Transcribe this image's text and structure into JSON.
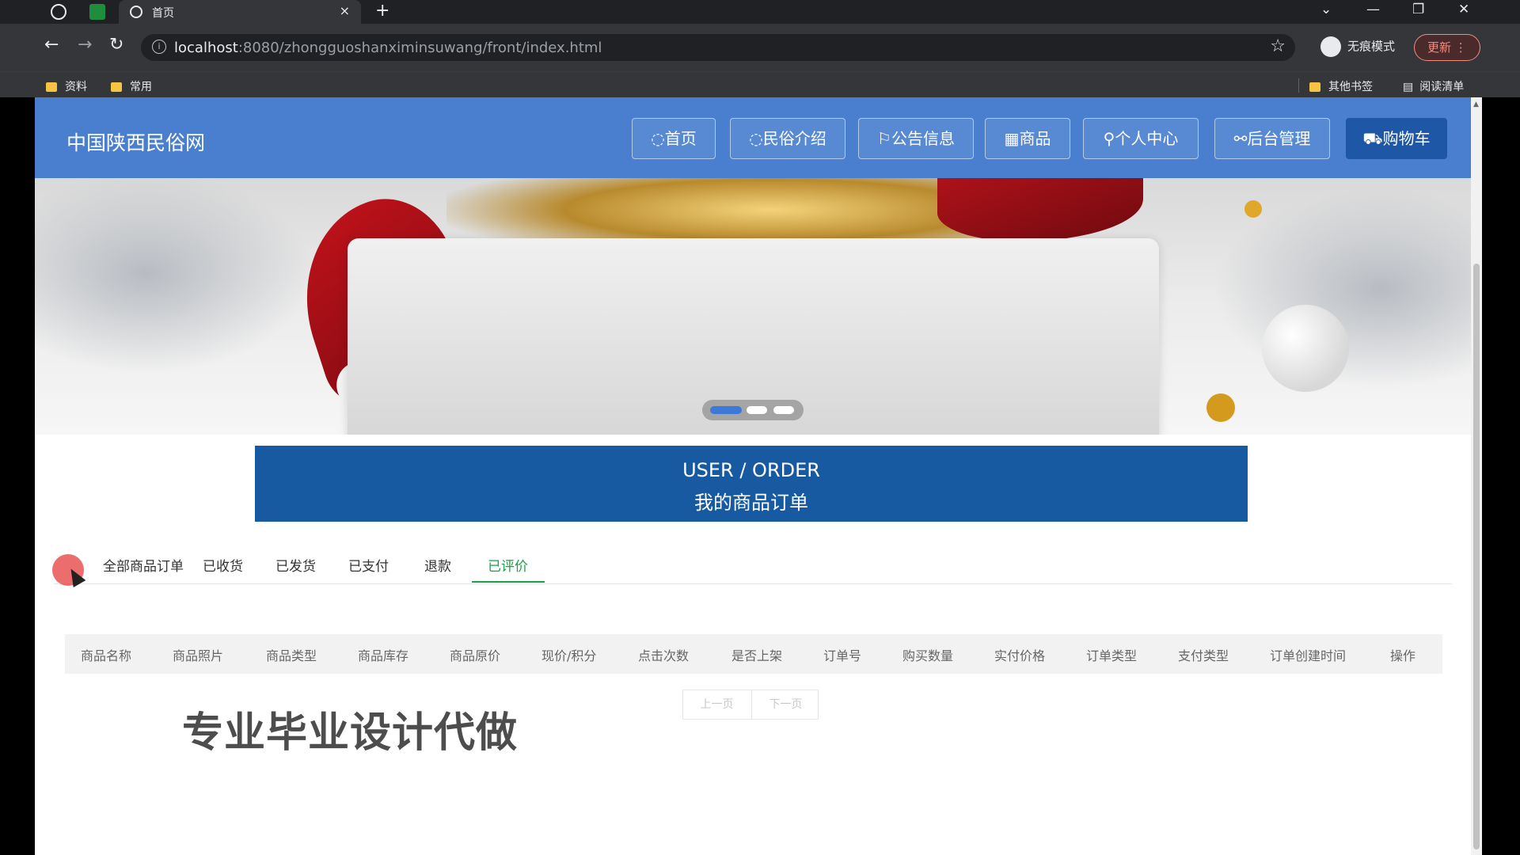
{
  "browser": {
    "tab_title": "首页",
    "tab_close": "×",
    "new_tab": "+",
    "url_host": "localhost",
    "url_rest": ":8080/zhongguoshanximinsuwang/front/index.html",
    "incognito_label": "无痕模式",
    "update_label": "更新",
    "bookmarks": [
      "资料",
      "常用"
    ],
    "other_bookmarks": "其他书签",
    "reading_list": "阅读清单"
  },
  "site": {
    "brand": "中国陕西民俗网",
    "nav": [
      "◌首页",
      "◌民俗介绍",
      "⚐公告信息",
      "▦商品",
      "⚲个人中心",
      "⚯后台管理",
      "⛟购物车"
    ]
  },
  "section": {
    "title_en": "USER / ORDER",
    "title_cn": "我的商品订单"
  },
  "order_tabs": {
    "items": [
      "全部商品订单",
      "已收货",
      "已发货",
      "已支付",
      "退款",
      "已评价"
    ],
    "active": "已评价"
  },
  "table": {
    "headers": [
      "商品名称",
      "商品照片",
      "商品类型",
      "商品库存",
      "商品原价",
      "现价/积分",
      "点击次数",
      "是否上架",
      "订单号",
      "购买数量",
      "实付价格",
      "订单类型",
      "支付类型",
      "订单创建时间",
      "操作"
    ],
    "rows": []
  },
  "pager": {
    "prev": "上一页",
    "next": "下一页"
  },
  "watermark": "专业毕业设计代做",
  "colors": {
    "header_bg": "#4a7fd0",
    "title_bar_bg": "#175aa1",
    "active_tab": "#1a9f4a"
  }
}
